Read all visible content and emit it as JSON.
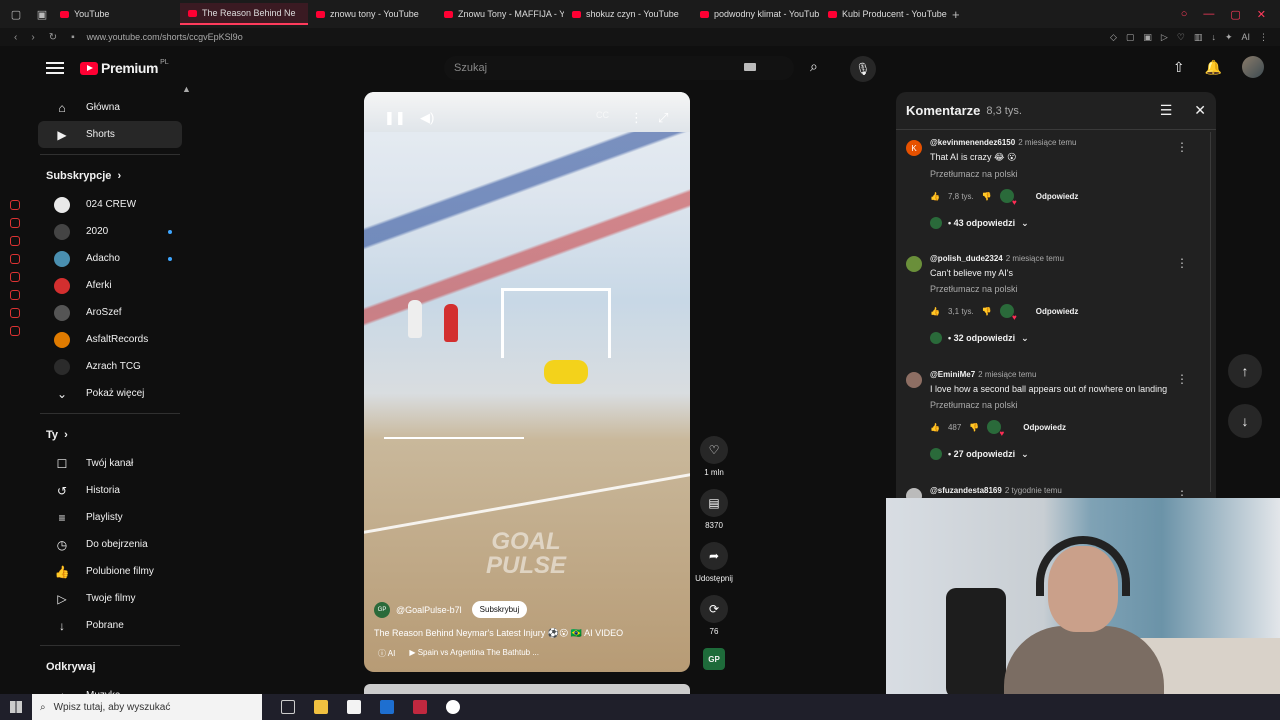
{
  "browser": {
    "tabs": [
      {
        "label": "YouTube",
        "active": false
      },
      {
        "label": "The Reason Behind Ne",
        "active": true
      },
      {
        "label": "znowu tony - YouTube",
        "active": false
      },
      {
        "label": "Znowu Tony - MAFFIJA - Y",
        "active": false
      },
      {
        "label": "shokuz czyn - YouTube",
        "active": false
      },
      {
        "label": "podwodny klimat - YouTub",
        "active": false
      },
      {
        "label": "Kubi Producent - YouTube",
        "active": false
      }
    ],
    "new_tab": "+",
    "url": "www.youtube.com/shorts/ccgvEpKSl9o",
    "ai_label": "AI"
  },
  "header": {
    "logo_text": "Premium",
    "logo_region": "PL",
    "search_placeholder": "Szukaj"
  },
  "sidebar": {
    "main": [
      {
        "label": "Główna",
        "icon": "home-icon"
      },
      {
        "label": "Shorts",
        "icon": "shorts-icon",
        "active": true
      }
    ],
    "subs_title": "Subskrypcje",
    "subs": [
      {
        "label": "024 CREW",
        "color": "#e9e9e9",
        "dot": false
      },
      {
        "label": "2020",
        "color": "#444444",
        "dot": true
      },
      {
        "label": "Adacho",
        "color": "#4a8fb0",
        "dot": true
      },
      {
        "label": "Aferki",
        "color": "#d32f2f",
        "dot": false
      },
      {
        "label": "AroSzef",
        "color": "#555555",
        "dot": false
      },
      {
        "label": "AsfaltRecords",
        "color": "#e07b00",
        "dot": false
      },
      {
        "label": "Azrach TCG",
        "color": "#2b2b2b",
        "dot": false
      }
    ],
    "show_more": "Pokaż więcej",
    "you_title": "Ty",
    "you": [
      {
        "label": "Twój kanał",
        "icon": "channel-icon"
      },
      {
        "label": "Historia",
        "icon": "history-icon"
      },
      {
        "label": "Playlisty",
        "icon": "playlist-icon"
      },
      {
        "label": "Do obejrzenia",
        "icon": "clock-icon"
      },
      {
        "label": "Polubione filmy",
        "icon": "like-icon"
      },
      {
        "label": "Twoje filmy",
        "icon": "video-icon"
      },
      {
        "label": "Pobrane",
        "icon": "download-icon"
      }
    ],
    "explore_title": "Odkrywaj",
    "explore": [
      {
        "label": "Muzyka",
        "icon": "music-icon"
      }
    ]
  },
  "video": {
    "watermark_line1": "GOAL",
    "watermark_line2": "PULSE",
    "channel": "@GoalPulse-b7l",
    "channel_avatar": "GP",
    "subscribe": "Subskrybuj",
    "title": "The Reason Behind Neymar's Latest Injury ⚽😮 🇧🇷 AI VIDEO",
    "tag": "AI",
    "related": "Spain vs Argentina The Bathtub ..."
  },
  "actions": {
    "likes": "1 mln",
    "comments": "8370",
    "share": "Udostępnij",
    "remix": "76",
    "channel_thumb": "GP"
  },
  "comments": {
    "title": "Komentarze",
    "count": "8,3 tys.",
    "translate": "Przetłumacz na polski",
    "reply_label": "Odpowiedz",
    "items": [
      {
        "user": "@kevinmenendez6150",
        "ago": "2 miesiące temu",
        "text": "That AI is crazy 😂 😮",
        "likes": "7,8 tys.",
        "replies": "• 43 odpowiedzi",
        "avatar": "K",
        "avatar_color": "#e65100"
      },
      {
        "user": "@polish_dude2324",
        "ago": "2 miesiące temu",
        "text": "Can't believe my AI's",
        "likes": "3,1 tys.",
        "replies": "• 32 odpowiedzi",
        "avatar": "",
        "avatar_color": "#6a8f3a"
      },
      {
        "user": "@EminiMe7",
        "ago": "2 miesiące temu",
        "text": "I love how a second ball appears out of nowhere on landing",
        "likes": "487",
        "replies": "• 27 odpowiedzi",
        "avatar": "",
        "avatar_color": "#8d6e63"
      },
      {
        "user": "@sfuzandesta8169",
        "ago": "2 tygodnie temu",
        "text": "",
        "likes": "",
        "replies": "",
        "avatar": "",
        "avatar_color": "#bbbbbb"
      }
    ]
  },
  "taskbar": {
    "search_placeholder": "Wpisz tutaj, aby wyszukać"
  }
}
